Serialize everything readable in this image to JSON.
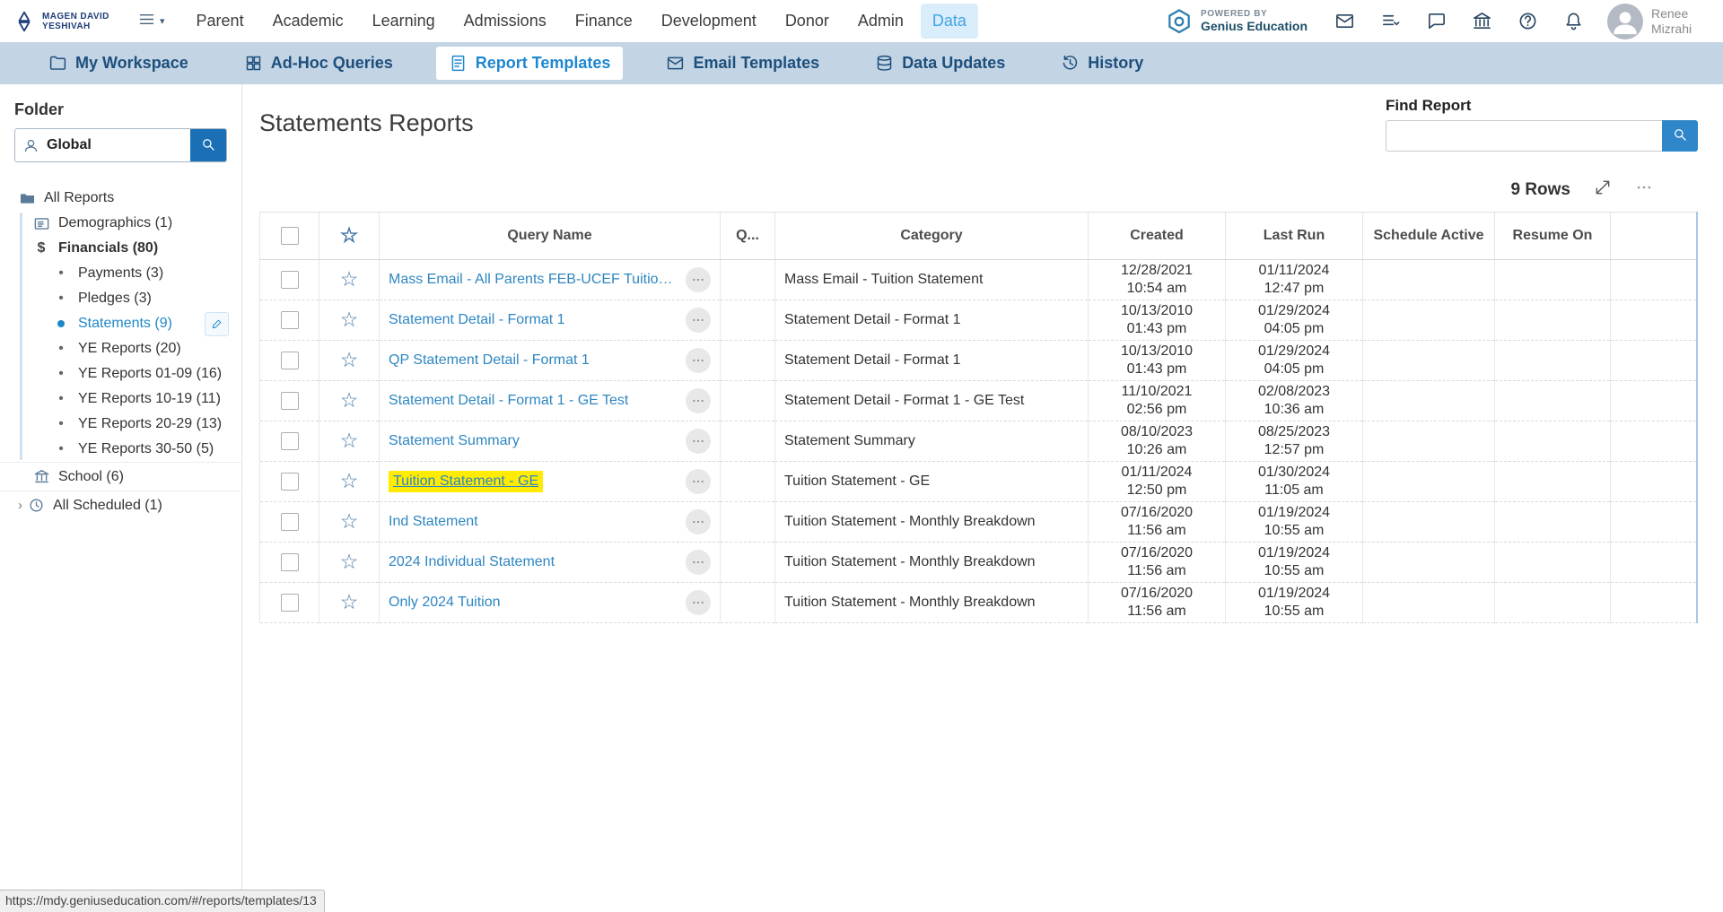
{
  "top_nav": {
    "logo_text": "MAGEN DAVID YESHIVAH",
    "items": [
      {
        "label": "Parent",
        "active": false
      },
      {
        "label": "Academic",
        "active": false
      },
      {
        "label": "Learning",
        "active": false
      },
      {
        "label": "Admissions",
        "active": false
      },
      {
        "label": "Finance",
        "active": false
      },
      {
        "label": "Development",
        "active": false
      },
      {
        "label": "Donor",
        "active": false
      },
      {
        "label": "Admin",
        "active": false
      },
      {
        "label": "Data",
        "active": true
      }
    ],
    "powered_by": {
      "line1": "POWERED BY",
      "line2": "Genius Education"
    },
    "icons": [
      "envelope-icon",
      "forms-icon",
      "chat-icon",
      "organization-icon",
      "help-icon",
      "bell-icon"
    ],
    "user_name": "Renee Mizrahi"
  },
  "tab_bar": [
    {
      "label": "My Workspace",
      "icon": "workspace-icon",
      "active": false
    },
    {
      "label": "Ad-Hoc Queries",
      "icon": "adhoc-grid-icon",
      "active": false
    },
    {
      "label": "Report Templates",
      "icon": "report-template-icon",
      "active": true
    },
    {
      "label": "Email Templates",
      "icon": "email-template-icon",
      "active": false
    },
    {
      "label": "Data Updates",
      "icon": "data-updates-icon",
      "active": false
    },
    {
      "label": "History",
      "icon": "history-icon",
      "active": false
    }
  ],
  "sidebar": {
    "folder_label": "Folder",
    "search_value": "Global",
    "tree": [
      {
        "label": "All Reports",
        "icon": "folder-open-icon",
        "level": 0
      },
      {
        "label": "Demographics (1)",
        "icon": "card-icon",
        "level": 1,
        "in_group": true
      },
      {
        "label": "Financials (80)",
        "icon": "dollar-icon",
        "level": 1,
        "bold": true,
        "in_group": true
      },
      {
        "label": "Payments (3)",
        "icon": "bullet",
        "level": 2,
        "in_group": true
      },
      {
        "label": "Pledges (3)",
        "icon": "bullet",
        "level": 2,
        "in_group": true
      },
      {
        "label": "Statements (9)",
        "icon": "dot",
        "level": 2,
        "in_group": true,
        "selected": true,
        "edit_button": true
      },
      {
        "label": "YE Reports (20)",
        "icon": "bullet",
        "level": 2,
        "in_group": true
      },
      {
        "label": "YE Reports 01-09 (16)",
        "icon": "bullet",
        "level": 2,
        "in_group": true
      },
      {
        "label": "YE Reports 10-19 (11)",
        "icon": "bullet",
        "level": 2,
        "in_group": true
      },
      {
        "label": "YE Reports 20-29 (13)",
        "icon": "bullet",
        "level": 2,
        "in_group": true
      },
      {
        "label": "YE Reports 30-50 (5)",
        "icon": "bullet",
        "level": 2,
        "in_group": true
      },
      {
        "label": "School (6)",
        "icon": "school-icon",
        "level": 1,
        "section": true
      },
      {
        "label": "All Scheduled (1)",
        "icon": "clock-icon",
        "level": 0,
        "chevron": true,
        "section": true
      }
    ]
  },
  "main": {
    "title": "Statements Reports",
    "find_report_label": "Find Report",
    "find_report_value": "",
    "rows_count": "9 Rows",
    "table": {
      "columns": [
        {
          "type": "checkbox",
          "label": "",
          "key": "select"
        },
        {
          "type": "star",
          "label": "",
          "key": "favorite"
        },
        {
          "type": "text",
          "label": "Query Name",
          "key": "query-name"
        },
        {
          "type": "text",
          "label": "Q...",
          "key": "q"
        },
        {
          "type": "text",
          "label": "Category",
          "key": "category"
        },
        {
          "type": "text",
          "label": "Created",
          "key": "created"
        },
        {
          "type": "text",
          "label": "Last Run",
          "key": "last-run"
        },
        {
          "type": "text",
          "label": "Schedule Active",
          "key": "schedule-active"
        },
        {
          "type": "text",
          "label": "Resume On",
          "key": "resume-on"
        },
        {
          "type": "text",
          "label": "",
          "key": "spacer"
        }
      ],
      "rows": [
        {
          "query_name": "Mass Email - All Parents FEB-UCEF Tuition S",
          "category": "Mass Email - Tuition Statement",
          "created": {
            "date": "12/28/2021",
            "time": "10:54 am"
          },
          "last_run": {
            "date": "01/11/2024",
            "time": "12:47 pm"
          },
          "highlighted": false
        },
        {
          "query_name": "Statement Detail - Format 1",
          "category": "Statement Detail - Format 1",
          "created": {
            "date": "10/13/2010",
            "time": "01:43 pm"
          },
          "last_run": {
            "date": "01/29/2024",
            "time": "04:05 pm"
          },
          "highlighted": false
        },
        {
          "query_name": "QP Statement Detail - Format 1",
          "category": "Statement Detail - Format 1",
          "created": {
            "date": "10/13/2010",
            "time": "01:43 pm"
          },
          "last_run": {
            "date": "01/29/2024",
            "time": "04:05 pm"
          },
          "highlighted": false
        },
        {
          "query_name": "Statement Detail - Format 1 - GE Test",
          "category": "Statement Detail - Format 1 - GE Test",
          "created": {
            "date": "11/10/2021",
            "time": "02:56 pm"
          },
          "last_run": {
            "date": "02/08/2023",
            "time": "10:36 am"
          },
          "highlighted": false
        },
        {
          "query_name": "Statement Summary",
          "category": "Statement Summary",
          "created": {
            "date": "08/10/2023",
            "time": "10:26 am"
          },
          "last_run": {
            "date": "08/25/2023",
            "time": "12:57 pm"
          },
          "highlighted": false
        },
        {
          "query_name": "Tuition Statement - GE",
          "category": "Tuition Statement - GE",
          "created": {
            "date": "01/11/2024",
            "time": "12:50 pm"
          },
          "last_run": {
            "date": "01/30/2024",
            "time": "11:05 am"
          },
          "highlighted": true
        },
        {
          "query_name": "Ind Statement",
          "category": "Tuition Statement - Monthly Breakdown",
          "created": {
            "date": "07/16/2020",
            "time": "11:56 am"
          },
          "last_run": {
            "date": "01/19/2024",
            "time": "10:55 am"
          },
          "highlighted": false
        },
        {
          "query_name": "2024 Individual Statement",
          "category": "Tuition Statement - Monthly Breakdown",
          "created": {
            "date": "07/16/2020",
            "time": "11:56 am"
          },
          "last_run": {
            "date": "01/19/2024",
            "time": "10:55 am"
          },
          "highlighted": false
        },
        {
          "query_name": "Only 2024 Tuition",
          "category": "Tuition Statement - Monthly Breakdown",
          "created": {
            "date": "07/16/2020",
            "time": "11:56 am"
          },
          "last_run": {
            "date": "01/19/2024",
            "time": "10:55 am"
          },
          "highlighted": false
        }
      ]
    }
  },
  "status_bar": {
    "url": "https://mdy.geniuseducation.com/#/reports/templates/13"
  }
}
